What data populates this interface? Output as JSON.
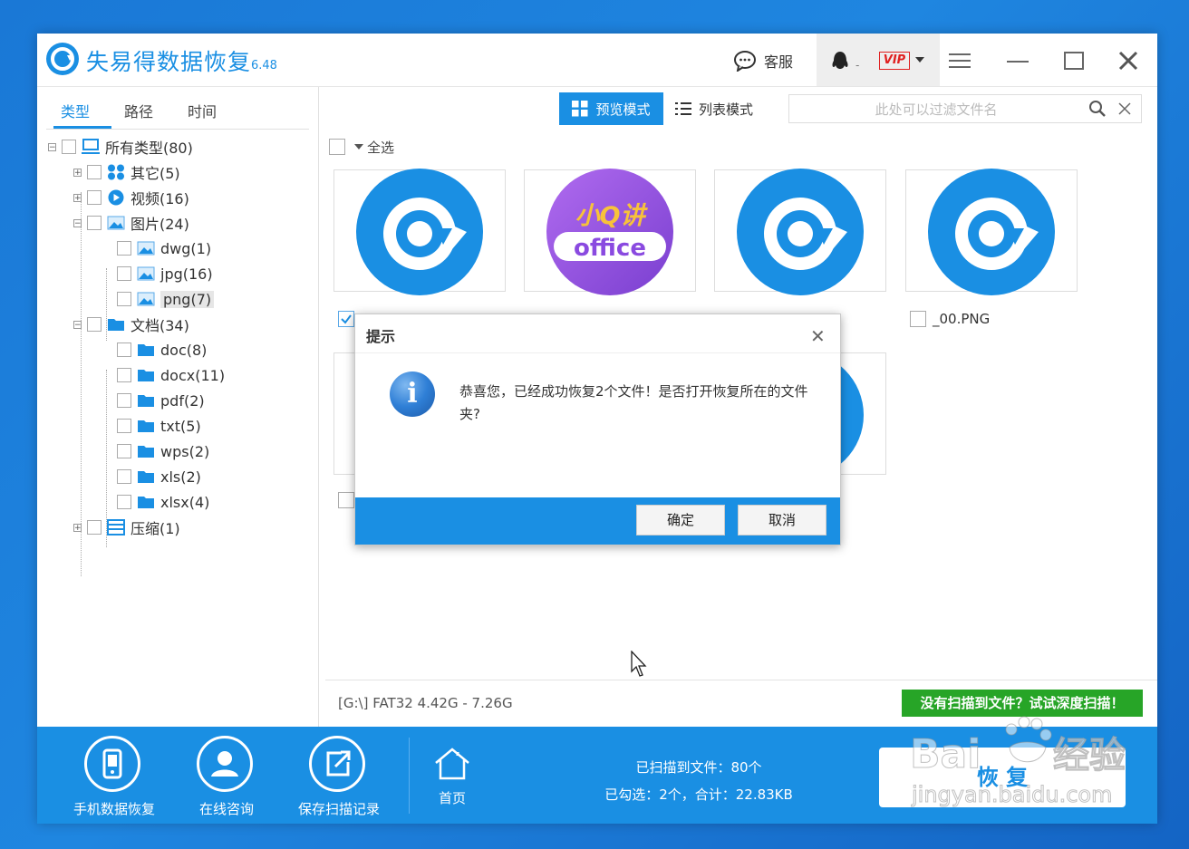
{
  "app": {
    "title": "失易得数据恢复",
    "version": "6.48"
  },
  "titlebar": {
    "service_label": "客服",
    "vip_label": "VIP",
    "separator": "-"
  },
  "left_tabs": [
    "类型",
    "路径",
    "时间"
  ],
  "tree": {
    "root": "所有类型(80)",
    "other": "其它(5)",
    "video": "视频(16)",
    "image": "图片(24)",
    "image_children": [
      "dwg(1)",
      "jpg(16)",
      "png(7)"
    ],
    "docs": "文档(34)",
    "doc_children": [
      "doc(8)",
      "docx(11)",
      "pdf(2)",
      "txt(5)",
      "wps(2)",
      "xls(2)",
      "xlsx(4)"
    ],
    "archive": "压缩(1)"
  },
  "toolbar": {
    "preview_mode": "预览模式",
    "list_mode": "列表模式",
    "search_placeholder": "此处可以过滤文件名"
  },
  "select_all": "全选",
  "files": [
    {
      "thumb": "app-logo-blue",
      "checked": true
    },
    {
      "thumb": "office-purple",
      "line1": "小Q讲",
      "line2": "office",
      "checked": false
    },
    {
      "thumb": "app-logo-blue",
      "checked": false
    },
    {
      "thumb": "app-logo-blue",
      "label": "_00.PNG",
      "checked": false
    }
  ],
  "status": {
    "drive": "[G:\\] FAT32 4.42G - 7.26G",
    "deep_scan": "没有扫描到文件？试试深度扫描！"
  },
  "bottom": {
    "phone": "手机数据恢复",
    "consult": "在线咨询",
    "save": "保存扫描记录",
    "home": "首页",
    "scanned": "已扫描到文件：80个",
    "selected": "已勾选：2个，合计：22.83KB",
    "recover": "恢 复"
  },
  "dialog": {
    "title": "提示",
    "message": "恭喜您，已经成功恢复2个文件！是否打开恢复所在的文件夹?",
    "ok": "确定",
    "cancel": "取消"
  },
  "watermark": {
    "line1": "Bai",
    "line2": "经验",
    "url": "jingyan.baidu.com"
  },
  "colors": {
    "accent": "#1a8fe3",
    "green": "#27a527",
    "vip": "#e02020"
  }
}
